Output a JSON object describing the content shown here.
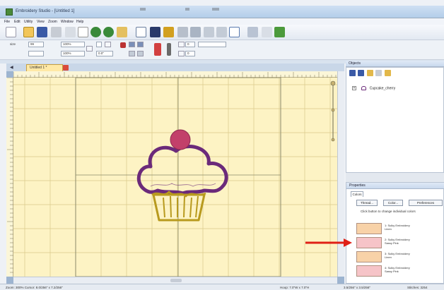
{
  "window": {
    "title": "Embroidery Studio - [Untitled 1]"
  },
  "menu": [
    "File",
    "Edit",
    "Utility",
    "View",
    "Zoom",
    "Window",
    "Help"
  ],
  "toolbar2": {
    "size_label": "size",
    "size_value": "99",
    "width_value": "100%",
    "height_value": "100%",
    "angle_value": "0.0\"",
    "rotate_label": "rot",
    "spin1": "0",
    "spin2": "0"
  },
  "document": {
    "tab_label": "Untitled 1 *",
    "design_colors": {
      "head": "#6b2a7a",
      "cherry": "#c2406a",
      "wrapper": "#b89a1e",
      "hoop_line": "#8a8a6a",
      "grid": "#d9c98a",
      "bg": "#fdf3c4"
    }
  },
  "objects_pane": {
    "header": "Objects",
    "tree_item": "Cupcake_cherry",
    "expander": "+"
  },
  "properties_pane": {
    "header": "Properties",
    "tab": "Colors",
    "buttons": [
      "Thread...",
      "Color...",
      "Preferences"
    ],
    "hint": "Click button to change individual colors",
    "colors": [
      {
        "line1": "1: Sulky Embroidery",
        "line2": "Linen",
        "swatch": "#f8d2a8"
      },
      {
        "line1": "2: Sulky Embroidery",
        "line2": "Sassy Pink",
        "swatch": "#f6c4c8"
      },
      {
        "line1": "3: Sulky Embroidery",
        "line2": "Linen",
        "swatch": "#f8d2a8"
      },
      {
        "line1": "4: Sulky Embroidery",
        "line2": "Sassy Pink",
        "swatch": "#f6c4c8"
      }
    ]
  },
  "status": {
    "left": "Zoom: 300%  Cursor: 8.0/256\" x 7.2/256\"",
    "mid": "Hoop: 7.0\"W x 7.0\"H",
    "right1": "3.5/256\" x 3.5/256\"",
    "right2": "Stitches: 3254"
  },
  "arrow_color": "#e02016"
}
